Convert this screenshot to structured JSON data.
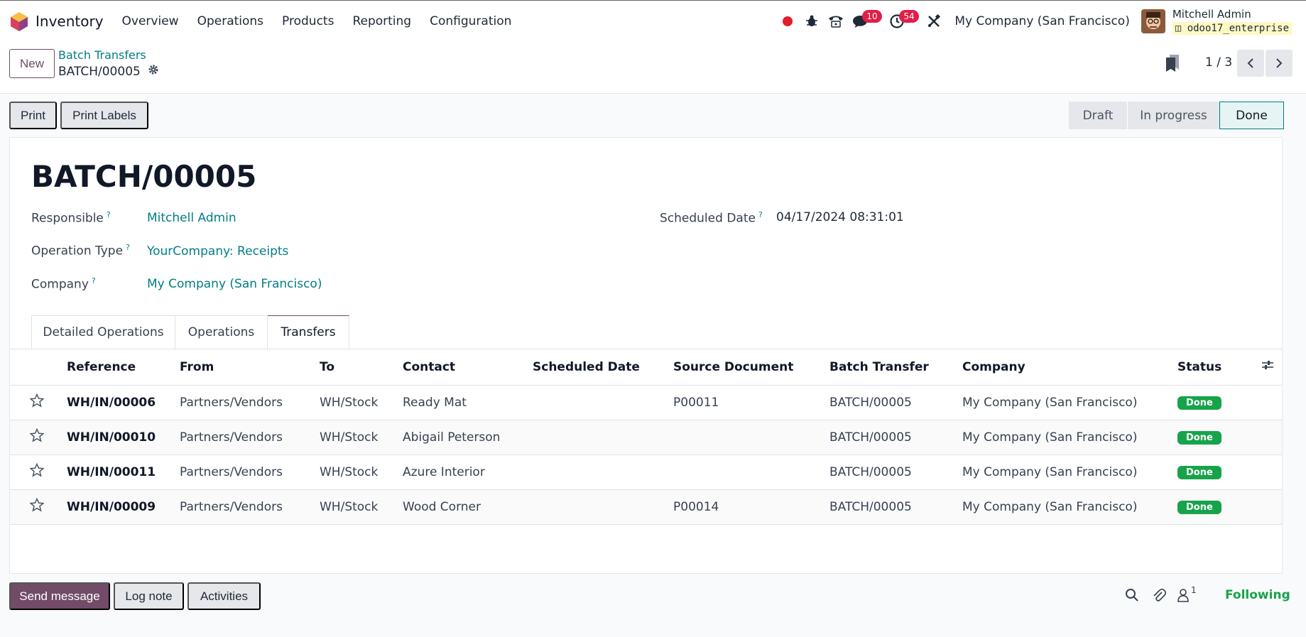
{
  "navbar": {
    "app_name": "Inventory",
    "menu": [
      "Overview",
      "Operations",
      "Products",
      "Reporting",
      "Configuration"
    ],
    "messages_count": "10",
    "activities_count": "54",
    "company": "My Company (San Francisco)",
    "user_name": "Mitchell Admin",
    "database": "odoo17_enterprise",
    "accent_color": "#714b67"
  },
  "control_panel": {
    "new_label": "New",
    "breadcrumb": "Batch Transfers",
    "record_name": "BATCH/00005",
    "pager": "1 / 3"
  },
  "actions": {
    "print_label": "Print",
    "print_labels_label": "Print Labels"
  },
  "statusbar": [
    "Draft",
    "In progress",
    "Done"
  ],
  "statusbar_active": "Done",
  "form": {
    "title": "BATCH/00005",
    "responsible_label": "Responsible",
    "responsible_value": "Mitchell Admin",
    "operation_type_label": "Operation Type",
    "operation_type_value": "YourCompany: Receipts",
    "company_label": "Company",
    "company_value": "My Company (San Francisco)",
    "scheduled_label": "Scheduled Date",
    "scheduled_value": "04/17/2024 08:31:01",
    "help": "?"
  },
  "tabs": [
    "Detailed Operations",
    "Operations",
    "Transfers"
  ],
  "tabs_active": "Transfers",
  "table": {
    "columns": [
      "Reference",
      "From",
      "To",
      "Contact",
      "Scheduled Date",
      "Source Document",
      "Batch Transfer",
      "Company",
      "Status"
    ],
    "rows": [
      {
        "reference": "WH/IN/00006",
        "from": "Partners/Vendors",
        "to": "WH/Stock",
        "contact": "Ready Mat",
        "scheduled": "",
        "source": "P00011",
        "batch": "BATCH/00005",
        "company": "My Company (San Francisco)",
        "status": "Done"
      },
      {
        "reference": "WH/IN/00010",
        "from": "Partners/Vendors",
        "to": "WH/Stock",
        "contact": "Abigail Peterson",
        "scheduled": "",
        "source": "",
        "batch": "BATCH/00005",
        "company": "My Company (San Francisco)",
        "status": "Done"
      },
      {
        "reference": "WH/IN/00011",
        "from": "Partners/Vendors",
        "to": "WH/Stock",
        "contact": "Azure Interior",
        "scheduled": "",
        "source": "",
        "batch": "BATCH/00005",
        "company": "My Company (San Francisco)",
        "status": "Done"
      },
      {
        "reference": "WH/IN/00009",
        "from": "Partners/Vendors",
        "to": "WH/Stock",
        "contact": "Wood Corner",
        "scheduled": "",
        "source": "P00014",
        "batch": "BATCH/00005",
        "company": "My Company (San Francisco)",
        "status": "Done"
      }
    ]
  },
  "chatter": {
    "send_label": "Send message",
    "log_label": "Log note",
    "activities_label": "Activities",
    "followers_count": "1",
    "following_label": "Following"
  }
}
